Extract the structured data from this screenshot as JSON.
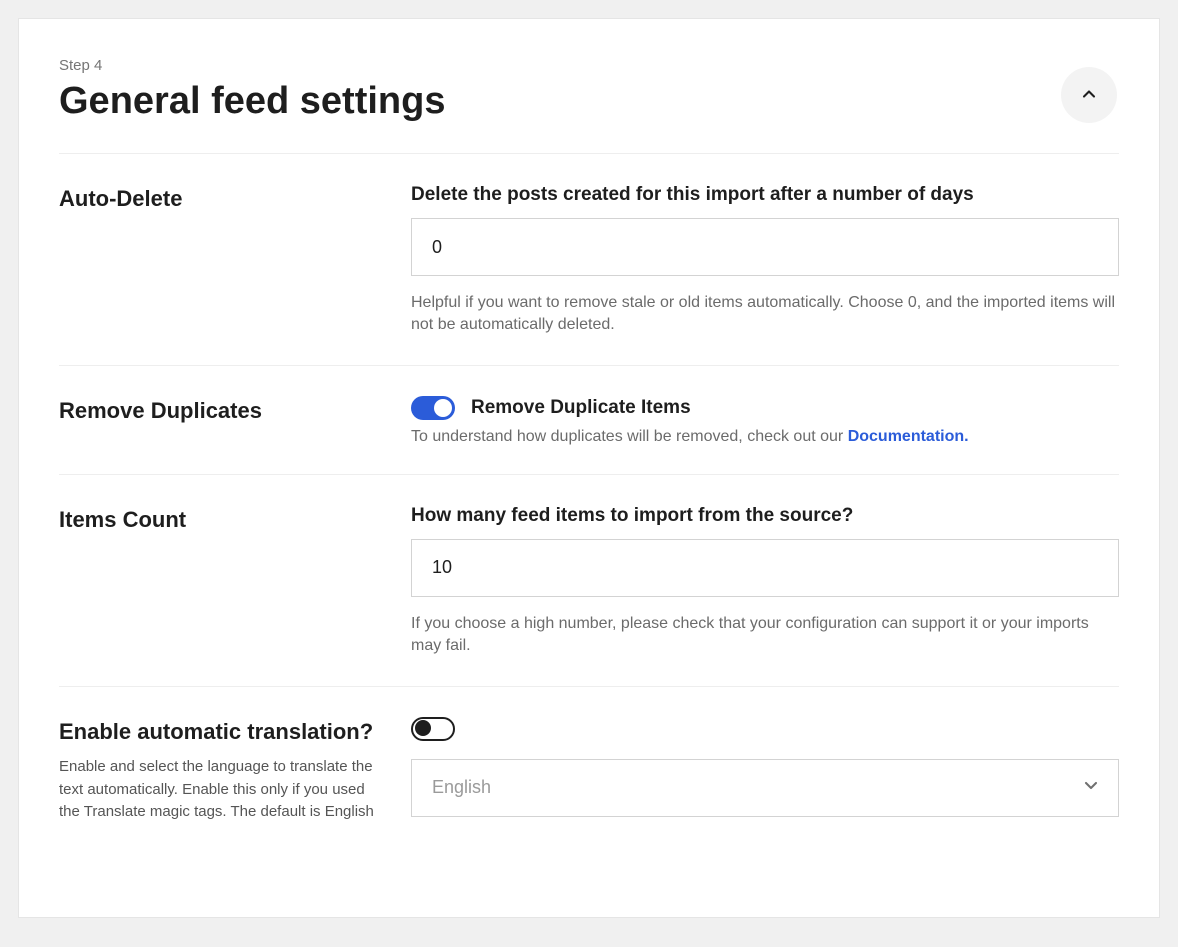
{
  "header": {
    "step": "Step 4",
    "title": "General feed settings"
  },
  "sections": {
    "autoDelete": {
      "label": "Auto-Delete",
      "fieldTitle": "Delete the posts created for this import after a number of days",
      "value": "0",
      "helper": "Helpful if you want to remove stale or old items automatically. Choose 0, and the imported items will not be automatically deleted."
    },
    "removeDuplicates": {
      "label": "Remove Duplicates",
      "toggleLabel": "Remove Duplicate Items",
      "toggleOn": true,
      "helperPrefix": "To understand how duplicates will be removed, check out our ",
      "docLink": "Documentation."
    },
    "itemsCount": {
      "label": "Items Count",
      "fieldTitle": "How many feed items to import from the source?",
      "value": "10",
      "helper": "If you choose a high number, please check that your configuration can support it or your imports may fail."
    },
    "translation": {
      "label": "Enable automatic translation?",
      "sub": "Enable and select the language to translate the text automatically. Enable this only if you used the Translate magic tags. The default is English",
      "toggleOn": false,
      "selectValue": "English"
    }
  }
}
